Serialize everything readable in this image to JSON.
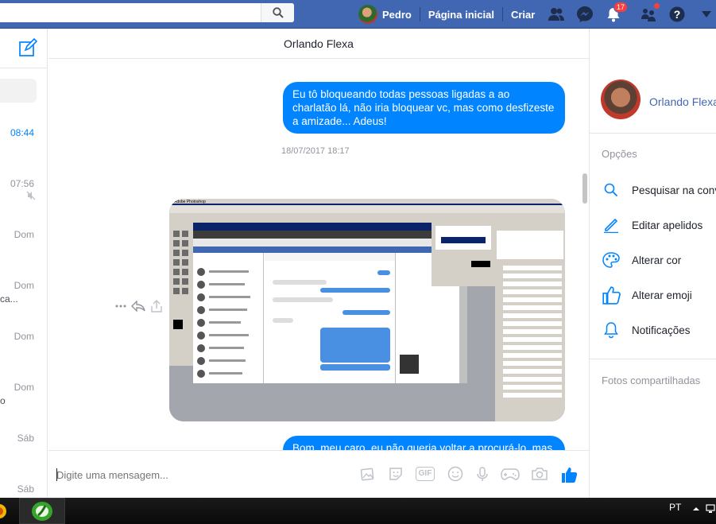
{
  "header": {
    "user_name": "Pedro",
    "home_label": "Página inicial",
    "create_label": "Criar",
    "notifications_count": "17"
  },
  "left_list": {
    "times": [
      "08:44",
      "07:56",
      "Dom",
      "Dom",
      "Dom",
      "Dom",
      "Sáb",
      "Sáb"
    ],
    "snippets": [
      "ca...",
      "o"
    ]
  },
  "conversation": {
    "title": "Orlando Flexa",
    "messages": [
      {
        "type": "text",
        "text": "Eu tô bloqueando todas pessoas ligadas a ao charlatão lá, não iria bloquear vc, mas como desfizeste a amizade... Adeus!"
      },
      {
        "type": "timestamp",
        "text": "18/07/2017 18:17"
      },
      {
        "type": "image",
        "text": "Adobe Photoshop"
      },
      {
        "type": "text",
        "text": "Bom, meu caro, eu não queria voltar a procurá-lo, mas o Alexey citou seu nome na declaração que fez para a Polícia contra mim. Gostaria de conversar com"
      }
    ],
    "composer_placeholder": "Digite uma mensagem...",
    "gif_label": "GIF"
  },
  "details": {
    "contact_name": "Orlando Flexa",
    "options_title": "Opções",
    "options": [
      {
        "label": "Pesquisar na conversa",
        "icon": "search-icon"
      },
      {
        "label": "Editar apelidos",
        "icon": "pencil-icon"
      },
      {
        "label": "Alterar cor",
        "icon": "palette-icon"
      },
      {
        "label": "Alterar emoji",
        "icon": "thumbs-up-icon"
      },
      {
        "label": "Notificações",
        "icon": "bell-icon"
      }
    ],
    "shared_photos_title": "Fotos compartilhadas"
  },
  "taskbar": {
    "language": "PT"
  },
  "colors": {
    "facebook_blue": "#4267b2",
    "messenger_blue": "#0084ff",
    "badge_red": "#fa3e3e"
  }
}
